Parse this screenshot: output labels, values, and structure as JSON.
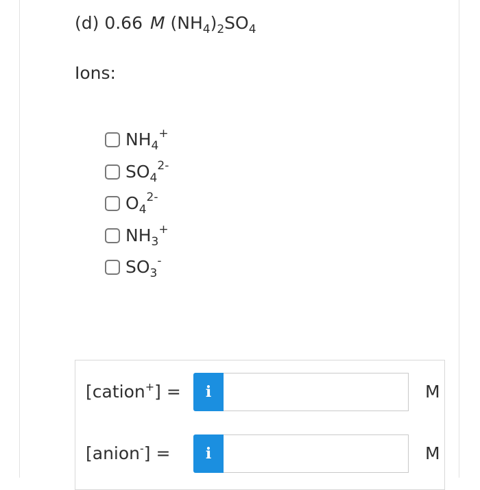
{
  "question": {
    "prefix": "(d) 0.66",
    "molar_symbol": "M",
    "formula": {
      "open": "(NH",
      "sub1": "4",
      "close": ")",
      "sub2": "2",
      "rest": "SO",
      "sub3": "4"
    }
  },
  "ions_label": "Ions:",
  "options": [
    {
      "base": "NH",
      "sub": "4",
      "sup": "+"
    },
    {
      "base": "SO",
      "sub": "4",
      "sup": "2-"
    },
    {
      "base": "O",
      "sub": "4",
      "sup": "2-"
    },
    {
      "base": "NH",
      "sub": "3",
      "sup": "+"
    },
    {
      "base": "SO",
      "sub": "3",
      "sup": "-"
    }
  ],
  "answers": {
    "cation": {
      "label_pre": "[cation",
      "label_sup": "+",
      "label_post": "] =",
      "info_icon": "i",
      "value": "",
      "unit": "M"
    },
    "anion": {
      "label_pre": "[anion",
      "label_sup": "-",
      "label_post": "] =",
      "info_icon": "i",
      "value": "",
      "unit": "M"
    }
  },
  "colors": {
    "info_button": "#1b8fe0",
    "text": "#2f2f2f"
  }
}
